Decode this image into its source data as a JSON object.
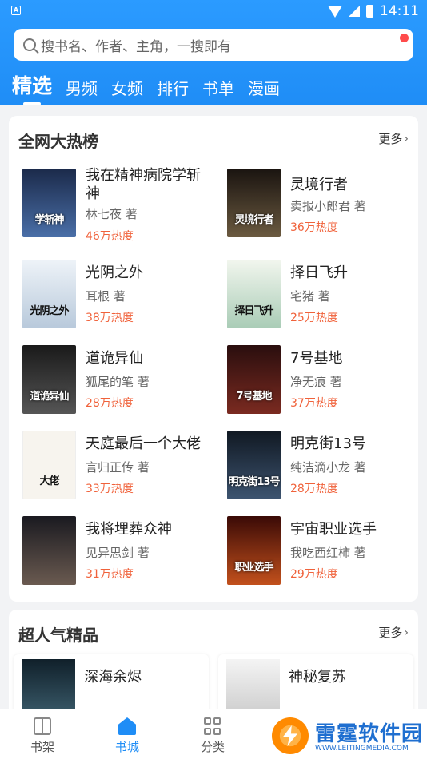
{
  "status": {
    "time": "14:11",
    "app_badge": "A"
  },
  "search": {
    "placeholder": "搜书名、作者、主角，一搜即有"
  },
  "tabs": [
    {
      "label": "精选",
      "active": true
    },
    {
      "label": "男频"
    },
    {
      "label": "女频"
    },
    {
      "label": "排行"
    },
    {
      "label": "书单"
    },
    {
      "label": "漫画"
    }
  ],
  "hot": {
    "title": "全网大热榜",
    "more": "更多",
    "books": [
      {
        "title": "我在精神病院学斩神",
        "author": "林七夜 著",
        "heat": "46万热度",
        "cover_text": "学斩神",
        "cover_color": "#2a3f6a"
      },
      {
        "title": "灵境行者",
        "author": "卖报小郎君 著",
        "heat": "36万热度",
        "cover_text": "灵境行者",
        "cover_color": "#2b2420"
      },
      {
        "title": "光阴之外",
        "author": "耳根 著",
        "heat": "38万热度",
        "cover_text": "光阴之外",
        "cover_color": "#d9e4ee"
      },
      {
        "title": "择日飞升",
        "author": "宅猪 著",
        "heat": "25万热度",
        "cover_text": "择日飞升",
        "cover_color": "#cfe3d8"
      },
      {
        "title": "道诡异仙",
        "author": "狐尾的笔 著",
        "heat": "28万热度",
        "cover_text": "道诡异仙",
        "cover_color": "#3a3a3a"
      },
      {
        "title": "7号基地",
        "author": "净无痕 著",
        "heat": "37万热度",
        "cover_text": "7号基地",
        "cover_color": "#3b1d1d"
      },
      {
        "title": "天庭最后一个大佬",
        "author": "言归正传 著",
        "heat": "33万热度",
        "cover_text": "大佬",
        "cover_color": "#f7f4ee"
      },
      {
        "title": "明克街13号",
        "author": "纯洁滴小龙 著",
        "heat": "28万热度",
        "cover_text": "明克街13号",
        "cover_color": "#1f2a3a"
      },
      {
        "title": "我将埋葬众神",
        "author": "见异思剑 著",
        "heat": "31万热度",
        "cover_text": "",
        "cover_color": "#2b2a30"
      },
      {
        "title": "宇宙职业选手",
        "author": "我吃西红柿 著",
        "heat": "29万热度",
        "cover_text": "职业选手",
        "cover_color": "#5a1a10"
      }
    ]
  },
  "popular": {
    "title": "超人气精品",
    "more": "更多",
    "books": [
      {
        "title": "深海余烬",
        "cover_color": "#2c4a58"
      },
      {
        "title": "神秘复苏",
        "cover_color": "#e8e8e8"
      }
    ]
  },
  "bottom_nav": [
    {
      "label": "书架",
      "icon": "bookshelf-icon"
    },
    {
      "label": "书城",
      "icon": "home-icon",
      "active": true
    },
    {
      "label": "分类",
      "icon": "grid-icon"
    }
  ],
  "watermark": {
    "title": "雷霆软件园",
    "url": "WWW.LEITINGMEDIA.COM"
  }
}
